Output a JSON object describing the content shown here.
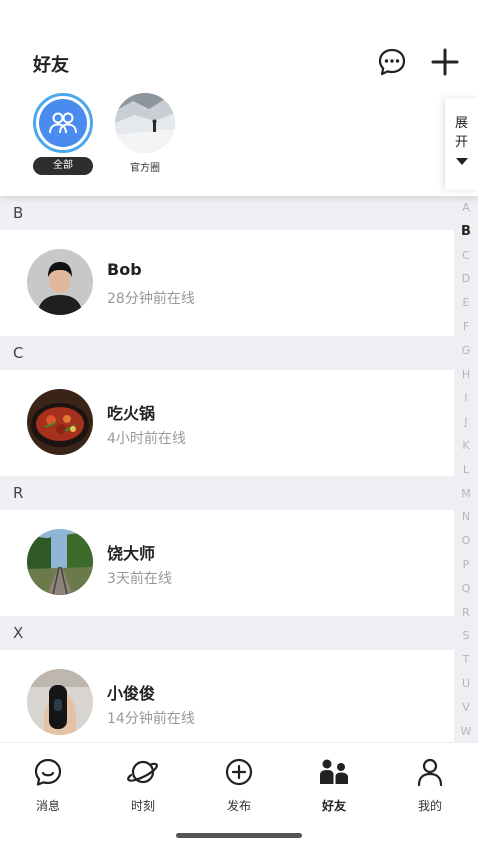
{
  "header": {
    "title": "好友"
  },
  "groups": [
    {
      "label": "全部",
      "selected": true
    },
    {
      "label": "官方圈",
      "selected": false
    }
  ],
  "expand": {
    "line1": "展",
    "line2": "开"
  },
  "sections": [
    {
      "letter": "B",
      "contacts": [
        {
          "name": "Bob",
          "status": "28分钟前在线"
        }
      ]
    },
    {
      "letter": "C",
      "contacts": [
        {
          "name": "吃火锅",
          "status": "4小时前在线"
        }
      ]
    },
    {
      "letter": "R",
      "contacts": [
        {
          "name": "饶大师",
          "status": "3天前在线"
        }
      ]
    },
    {
      "letter": "X",
      "contacts": [
        {
          "name": "小俊俊",
          "status": "14分钟前在线"
        }
      ]
    }
  ],
  "index": [
    "A",
    "B",
    "C",
    "D",
    "E",
    "F",
    "G",
    "H",
    "I",
    "J",
    "K",
    "L",
    "M",
    "N",
    "O",
    "P",
    "Q",
    "R",
    "S",
    "T",
    "U",
    "V",
    "W"
  ],
  "index_active": "B",
  "tabs": [
    {
      "label": "消息",
      "icon": "message-smile-icon"
    },
    {
      "label": "时刻",
      "icon": "planet-icon"
    },
    {
      "label": "发布",
      "icon": "plus-circle-icon"
    },
    {
      "label": "好友",
      "icon": "friends-icon",
      "active": true
    },
    {
      "label": "我的",
      "icon": "person-icon"
    }
  ],
  "colors": {
    "accent_blue": "#4a8bf0",
    "section_bg": "#eef0f4",
    "muted_text": "#999999"
  }
}
